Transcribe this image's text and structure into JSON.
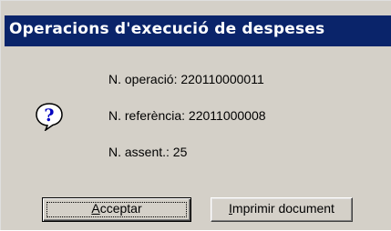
{
  "dialog": {
    "title": "Operacions d'execució de despeses",
    "icon": "question-icon",
    "lines": {
      "operation": "N. operació: 220110000011",
      "reference": "N. referència: 22011000008",
      "entry": "N. assent.: 25"
    },
    "buttons": {
      "accept": {
        "mnemonic": "A",
        "rest": "cceptar"
      },
      "print": {
        "mnemonic": "I",
        "rest": "mprimir document"
      }
    }
  }
}
